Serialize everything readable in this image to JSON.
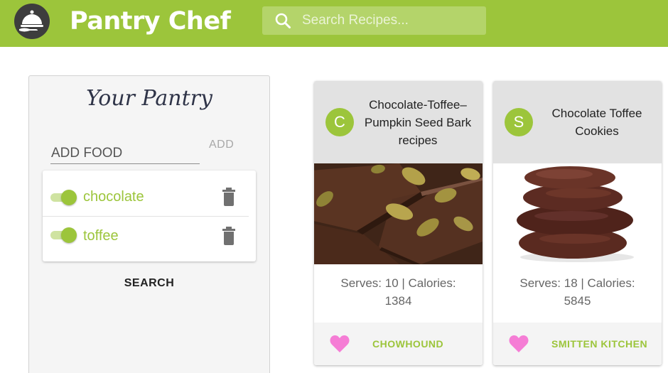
{
  "header": {
    "app_title": "Pantry Chef",
    "search_placeholder": "Search Recipes...",
    "logo_icon": "cloche-icon",
    "accent": "#9cc53b"
  },
  "pantry": {
    "title": "Your Pantry",
    "add_placeholder": "ADD FOOD",
    "add_label": "ADD",
    "items": [
      {
        "name": "chocolate",
        "enabled": true
      },
      {
        "name": "toffee",
        "enabled": true
      }
    ],
    "search_label": "SEARCH"
  },
  "recipes": [
    {
      "avatar_letter": "C",
      "title": "Chocolate-Toffee–Pumpkin Seed Bark recipes",
      "info": "Serves: 10 | Calories: 1384",
      "source": "CHOWHOUND",
      "favorite_icon": "heart-icon"
    },
    {
      "avatar_letter": "S",
      "title": "Chocolate Toffee Cookies",
      "info": "Serves: 18 | Calories: 5845",
      "source": "SMITTEN KITCHEN",
      "favorite_icon": "heart-icon"
    }
  ],
  "colors": {
    "brand_green": "#9cc53b",
    "heart_pink": "#f57dd5"
  }
}
